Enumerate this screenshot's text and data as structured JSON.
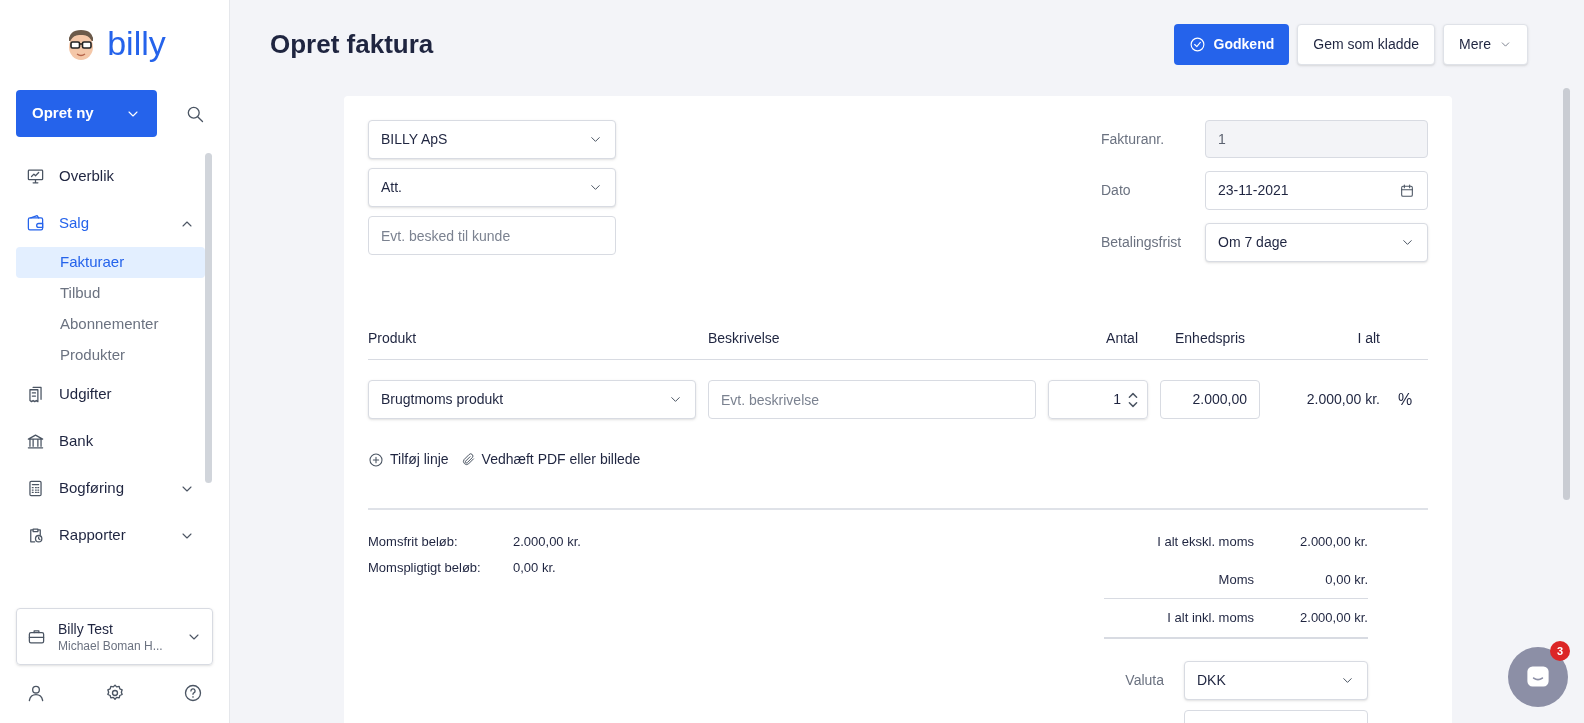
{
  "sidebar": {
    "logo": "billy",
    "create_button": "Opret ny",
    "nav": [
      {
        "label": "Overblik",
        "kind": "link",
        "selected": false
      },
      {
        "label": "Salg",
        "kind": "group",
        "expanded": true,
        "selected": false,
        "children": [
          {
            "label": "Fakturaer",
            "selected": true
          },
          {
            "label": "Tilbud",
            "selected": false
          },
          {
            "label": "Abonnementer",
            "selected": false
          },
          {
            "label": "Produkter",
            "selected": false
          }
        ]
      },
      {
        "label": "Udgifter",
        "kind": "link",
        "selected": false
      },
      {
        "label": "Bank",
        "kind": "link",
        "selected": false
      },
      {
        "label": "Bogføring",
        "kind": "group",
        "expanded": false,
        "selected": false
      },
      {
        "label": "Rapporter",
        "kind": "group",
        "expanded": false,
        "selected": false
      }
    ],
    "account": {
      "name": "Billy Test",
      "user": "Michael Boman H..."
    }
  },
  "header": {
    "title": "Opret faktura",
    "buttons": [
      {
        "label": "Godkend",
        "kind": "primary"
      },
      {
        "label": "Gem som kladde",
        "kind": "secondary"
      },
      {
        "label": "Mere",
        "kind": "menu"
      }
    ]
  },
  "customer": {
    "contact": "BILLY ApS",
    "attention": "Att.",
    "message_placeholder": "Evt. besked til kunde"
  },
  "details": [
    {
      "label": "Fakturanr.",
      "value": "1",
      "kind": "readonly"
    },
    {
      "label": "Dato",
      "value": "23-11-2021",
      "kind": "date"
    },
    {
      "label": "Betalingsfrist",
      "value": "Om 7 dage",
      "kind": "select"
    }
  ],
  "lines": {
    "columns": [
      "Produkt",
      "Beskrivelse",
      "Antal",
      "Enhedspris",
      "I alt"
    ],
    "rows": [
      {
        "product": "Brugtmoms produkt",
        "description_placeholder": "Evt. beskrivelse",
        "quantity": "1",
        "unit_price": "2.000,00",
        "total": "2.000,00 kr.",
        "vat": "%"
      }
    ],
    "actions": [
      {
        "label": "Tilføj linje",
        "kind": "add"
      },
      {
        "label": "Vedhæft PDF eller billede",
        "kind": "attach"
      }
    ]
  },
  "vat_summary": [
    {
      "label": "Momsfrit beløb:",
      "value": "2.000,00 kr."
    },
    {
      "label": "Momspligtigt beløb:",
      "value": "0,00 kr."
    }
  ],
  "totals": [
    {
      "label": "I alt ekskl. moms",
      "value": "2.000,00 kr."
    },
    {
      "label": "Moms",
      "value": "0,00 kr."
    },
    {
      "label": "I alt inkl. moms",
      "value": "2.000,00 kr."
    }
  ],
  "currency": {
    "label": "Valuta",
    "value": "DKK"
  },
  "chat": {
    "badge": "3"
  }
}
